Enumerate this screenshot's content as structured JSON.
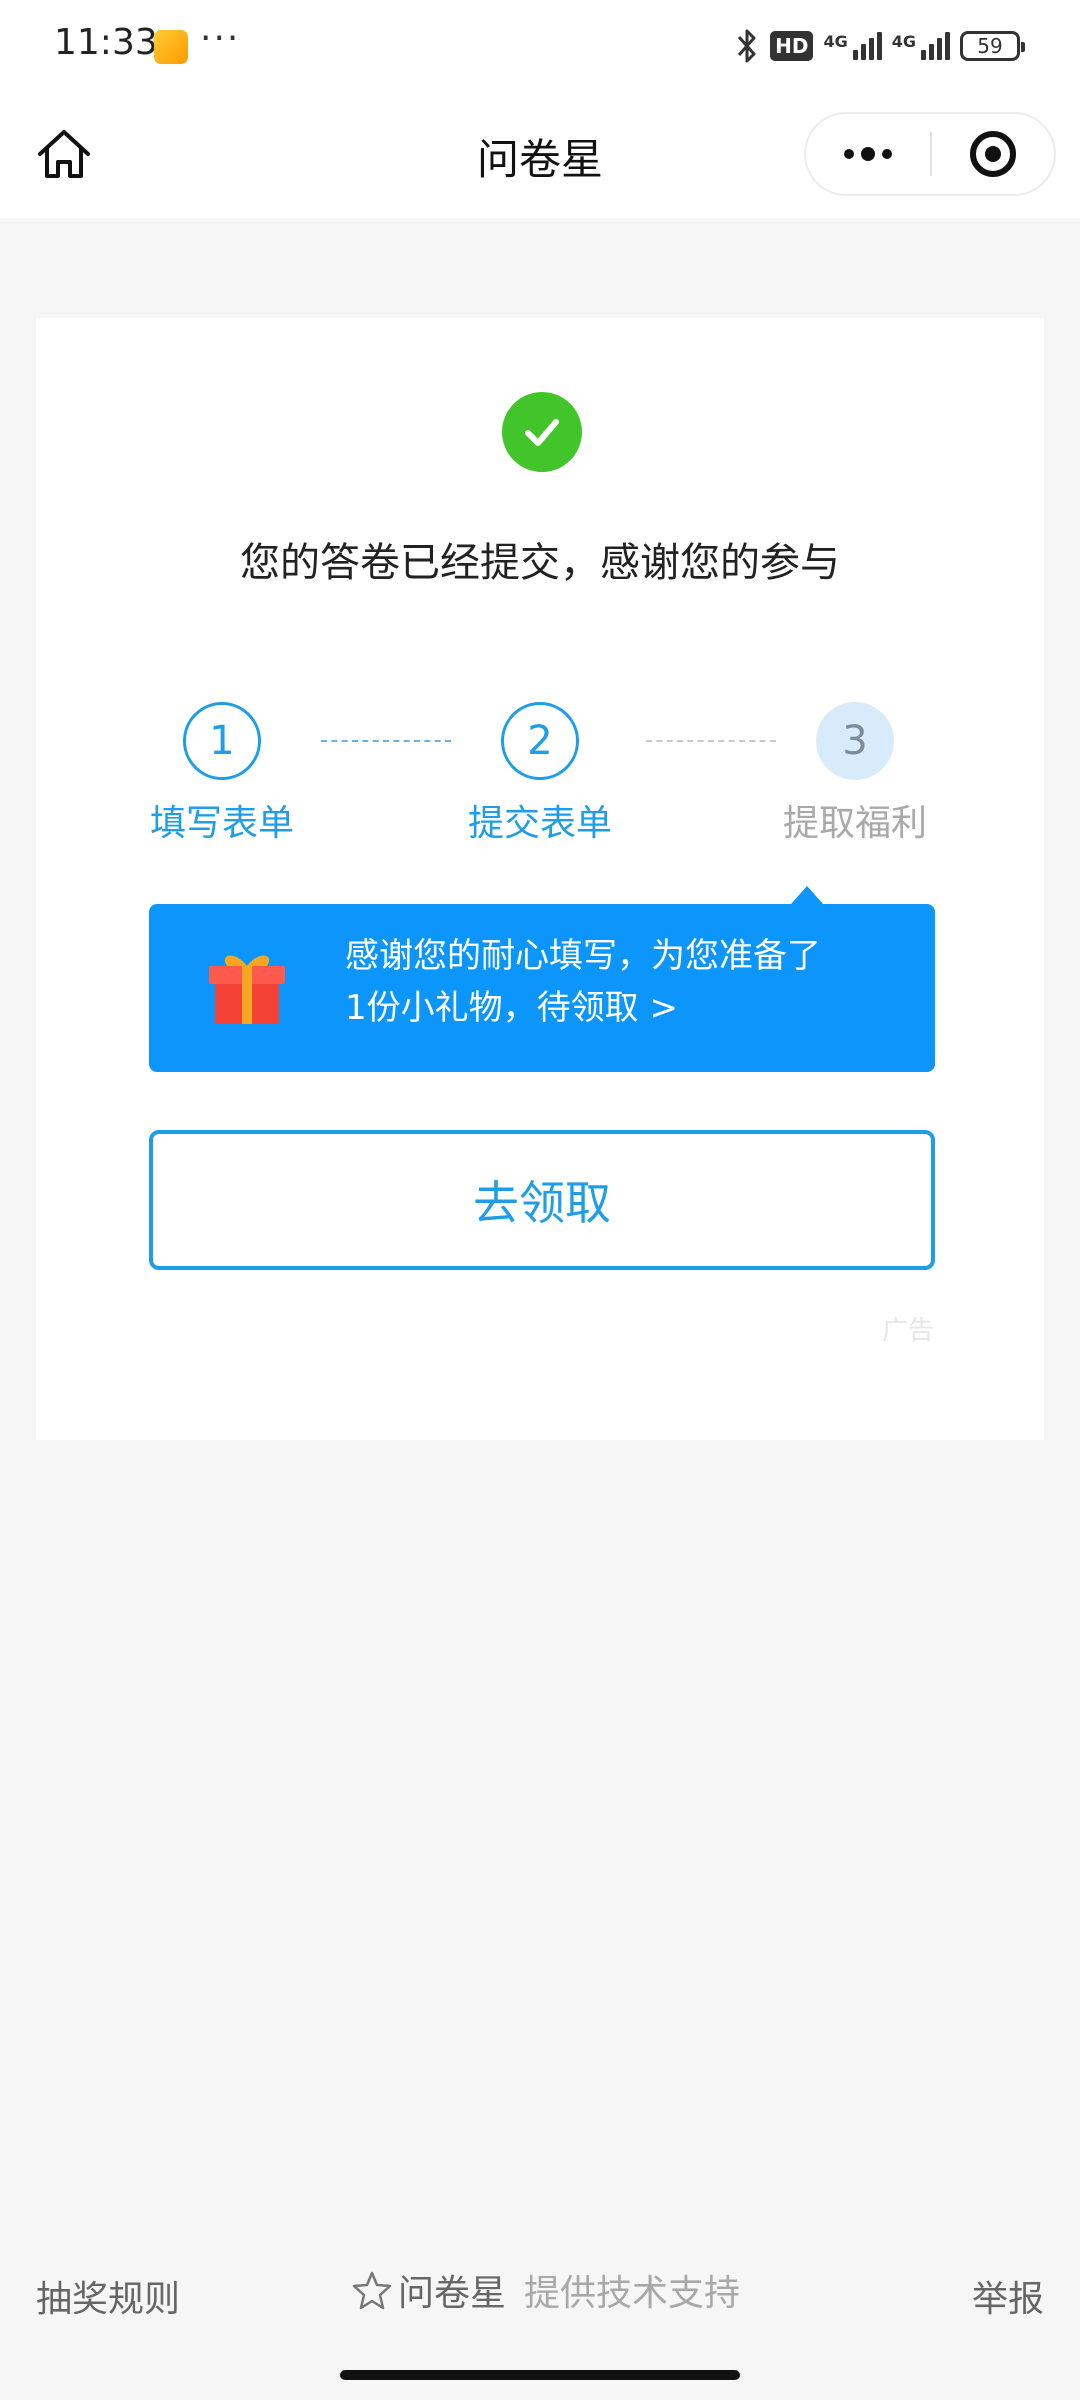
{
  "status_bar": {
    "time": "11:33",
    "more": "···",
    "hd_badge": "HD",
    "net1": "4G",
    "net2": "4G",
    "battery": "59"
  },
  "nav": {
    "title": "问卷星"
  },
  "card": {
    "success_text": "您的答卷已经提交，感谢您的参与",
    "steps": [
      {
        "number": "1",
        "label": "填写表单",
        "state": "done"
      },
      {
        "number": "2",
        "label": "提交表单",
        "state": "done"
      },
      {
        "number": "3",
        "label": "提取福利",
        "state": "pending"
      }
    ],
    "gift": {
      "line1": "感谢您的耐心填写，为您准备了",
      "line2": "1份小礼物，待领取 >"
    },
    "claim_button": "去领取",
    "ad_label": "广告"
  },
  "footer": {
    "left": "抽奖规则",
    "brand": "问卷星",
    "support": "提供技术支持",
    "right": "举报"
  },
  "colors": {
    "accent": "#1e9ee8",
    "gift_bg": "#0c96fb",
    "success": "#42c52a"
  }
}
